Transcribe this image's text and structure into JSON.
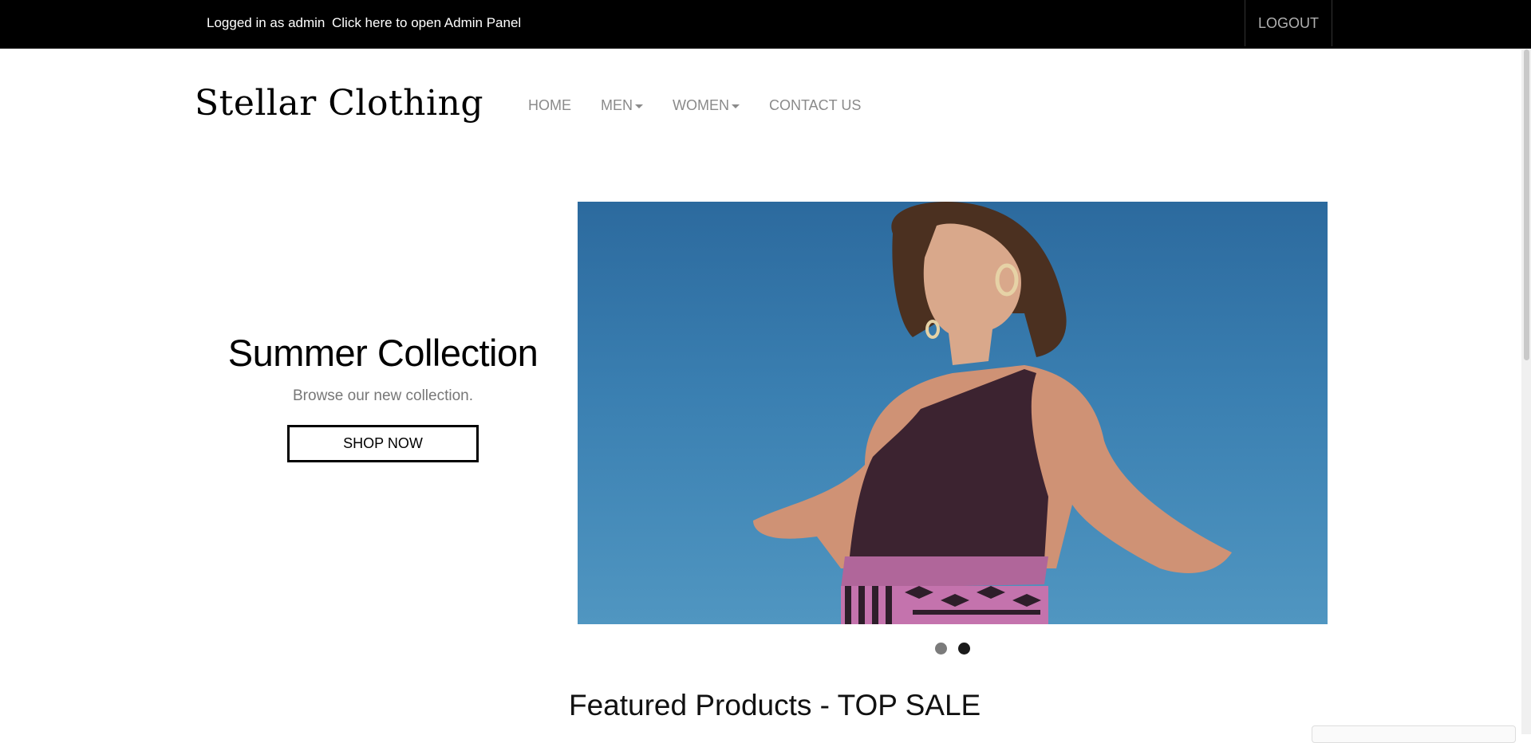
{
  "topbar": {
    "login_info": "Logged in as admin",
    "admin_link": "Click here to open Admin Panel",
    "logout_label": "LOGOUT"
  },
  "brand": {
    "name": "Stellar Clothing"
  },
  "nav": {
    "items": [
      {
        "label": "HOME",
        "dropdown": false
      },
      {
        "label": "MEN",
        "dropdown": true
      },
      {
        "label": "WOMEN",
        "dropdown": true
      },
      {
        "label": "CONTACT US",
        "dropdown": false
      }
    ]
  },
  "hero": {
    "title": "Summer Collection",
    "subtitle": "Browse our new collection.",
    "button_label": "SHOP NOW",
    "image_icon": "fashion-model-photo",
    "slide_count": 2,
    "active_slide": 2
  },
  "featured": {
    "heading": "Featured Products - TOP SALE"
  },
  "colors": {
    "topbar_bg": "#000000",
    "nav_text": "#8a8a8a",
    "sky_blue": "#3a7fb1"
  }
}
